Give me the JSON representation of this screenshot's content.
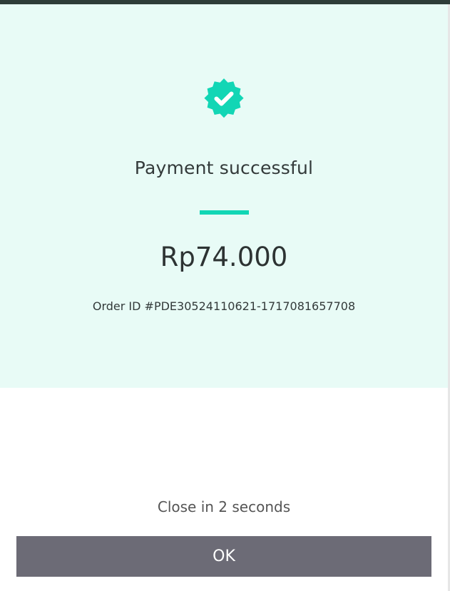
{
  "colors": {
    "accent": "#12d6b5",
    "panel_background": "#e8fbf6",
    "button_background": "#6c6b76",
    "top_bar": "#2e3d39"
  },
  "status": {
    "icon": "check-badge-icon",
    "title": "Payment successful"
  },
  "payment": {
    "amount": "Rp74.000",
    "order_id": "Order ID #PDE30524110621-1717081657708"
  },
  "footer": {
    "countdown": "Close in 2 seconds",
    "ok_label": "OK"
  }
}
